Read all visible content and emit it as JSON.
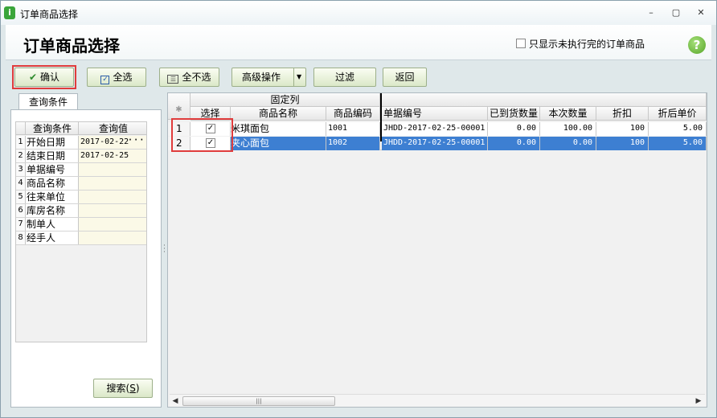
{
  "window": {
    "title": "订单商品选择",
    "controls": {
      "minimize": "–",
      "maximize": "▢",
      "close": "✕"
    }
  },
  "header": {
    "title": "订单商品选择",
    "only_unexecuted_label": "只显示未执行完的订单商品",
    "only_unexecuted_checked": false,
    "help_glyph": "?"
  },
  "toolbar": {
    "confirm_label": "确认",
    "select_all_label": "全选",
    "deselect_all_label": "全不选",
    "advanced_label": "高级操作",
    "filter_label": "过滤",
    "back_label": "返回"
  },
  "query_panel": {
    "tab_label": "查询条件",
    "columns": [
      "查询条件",
      "查询值"
    ],
    "rows": [
      {
        "n": "1",
        "name": "开始日期",
        "value": "2017-02-22"
      },
      {
        "n": "2",
        "name": "结束日期",
        "value": "2017-02-25"
      },
      {
        "n": "3",
        "name": "单据编号",
        "value": ""
      },
      {
        "n": "4",
        "name": "商品名称",
        "value": ""
      },
      {
        "n": "5",
        "name": "往来单位",
        "value": ""
      },
      {
        "n": "6",
        "name": "库房名称",
        "value": ""
      },
      {
        "n": "7",
        "name": "制单人",
        "value": ""
      },
      {
        "n": "8",
        "name": "经手人",
        "value": ""
      }
    ],
    "search_label": "搜索",
    "search_shortcut": "S"
  },
  "grid": {
    "fixed_group_label": "固定列",
    "columns": [
      "选择",
      "商品名称",
      "商品编码",
      "单据编号",
      "已到货数量",
      "本次数量",
      "折扣",
      "折后单价"
    ],
    "rows": [
      {
        "n": "1",
        "checked": true,
        "name": "米琪面包",
        "code": "1001",
        "doc": "JHDD-2017-02-25-00001",
        "arrived": "0.00",
        "qty": "100.00",
        "discount": "100",
        "price": "5.00",
        "selected": false
      },
      {
        "n": "2",
        "checked": true,
        "name": "夹心面包",
        "code": "1002",
        "doc": "JHDD-2017-02-25-00001",
        "arrived": "0.00",
        "qty": "0.00",
        "discount": "100",
        "price": "5.00",
        "selected": true
      }
    ]
  },
  "colors": {
    "highlight_red": "#e03c3c",
    "selection_blue": "#3d7fd2",
    "button_green_fill": "#dbe8c8",
    "confirm_check": "#2e8b2e"
  }
}
